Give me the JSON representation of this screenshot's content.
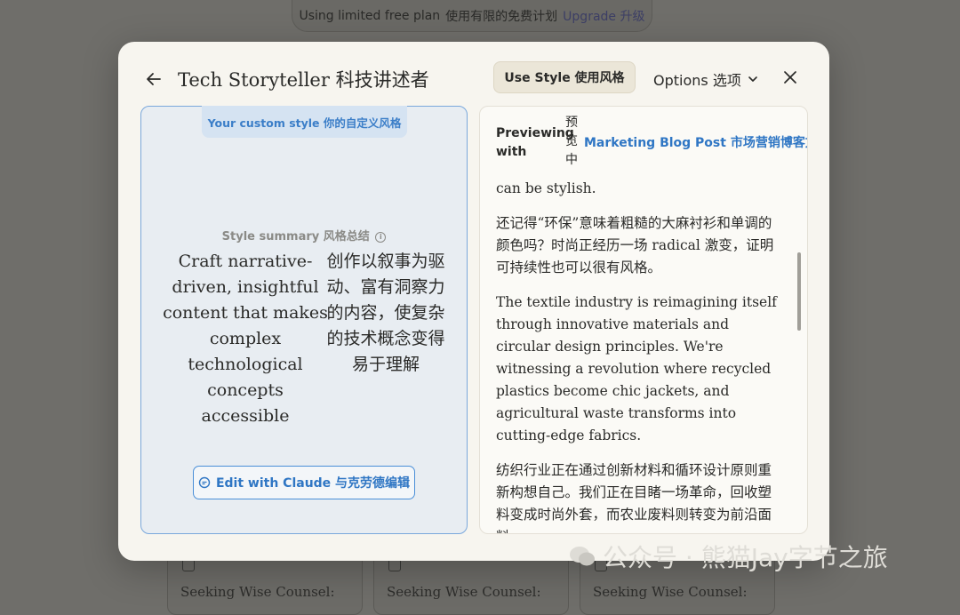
{
  "banner": {
    "plan": "Using limited free plan",
    "plan_zh": "使用有限的免费计划",
    "upgrade": "Upgrade 升级"
  },
  "background_cards": [
    "Seeking Wise Counsel:",
    "Seeking Wise Counsel:",
    "Seeking Wise Counsel:"
  ],
  "modal": {
    "title": "Tech Storyteller 科技讲述者",
    "use_style_label": "Use Style 使用风格",
    "options_label": "Options 选项"
  },
  "left_panel": {
    "tab_label": "Your custom style 你的自定义风格",
    "summary_label": "Style summary 风格总结",
    "summary_en": "Craft narrative-driven, insightful content that makes complex technological concepts accessible",
    "summary_zh": "创作以叙事为驱动、富有洞察力的内容，使复杂的技术概念变得易于理解",
    "edit_label": "Edit with Claude 与克劳德编辑"
  },
  "right_panel": {
    "previewing_label": "Previewing with",
    "previewing_zh": "预览中",
    "selected_style": "Marketing Blog Post 市场营销博客文章",
    "paragraphs": [
      "can be stylish.",
      "还记得“环保”意味着粗糙的大麻衬衫和单调的颜色吗？时尚正经历一场 radical 激变，证明可持续性也可以很有风格。",
      "The textile industry is reimagining itself through innovative materials and circular design principles. We're witnessing a revolution where recycled plastics become chic jackets, and agricultural waste transforms into cutting-edge fabrics.",
      "纺织行业正在通过创新材料和循环设计原则重新构想自己。我们正在目睹一场革命，回收塑料变成时尚外套，而农业废料则转变为前沿面料。"
    ]
  },
  "watermark": "公众号 · 熊猫Jay字节之旅"
}
